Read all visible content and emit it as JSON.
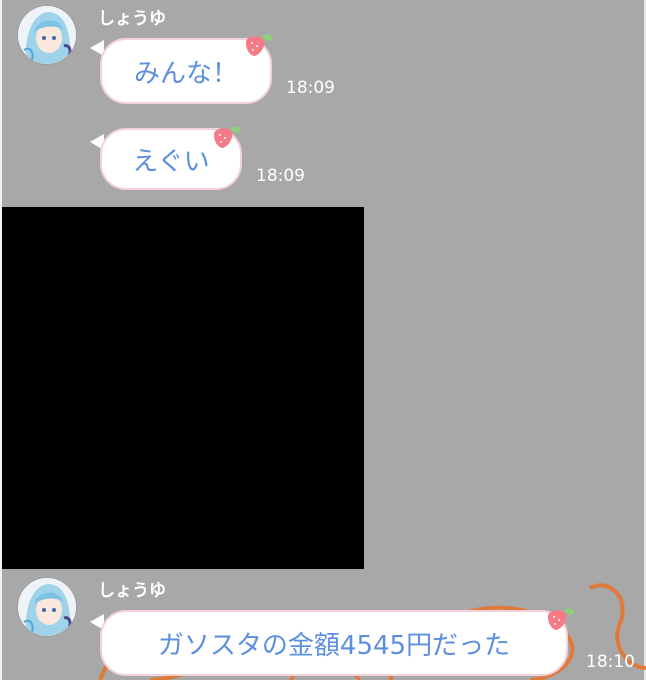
{
  "chat": {
    "messages": [
      {
        "sender": "しょうゆ",
        "text": "みんな！",
        "time": "18:09"
      },
      {
        "text": "えぐい",
        "time": "18:09"
      },
      {
        "sender": "しょうゆ",
        "text": "ガソスタの金額4545円だった",
        "time": "18:10"
      }
    ]
  },
  "colors": {
    "background": "#a8a8a8",
    "bubble_text": "#5d8fe0",
    "bubble_border": "#f2d1da",
    "image_placeholder": "#000000"
  },
  "icons": {
    "bubble_decoration": "strawberry-icon",
    "avatar": "avatar-anime-girl"
  }
}
